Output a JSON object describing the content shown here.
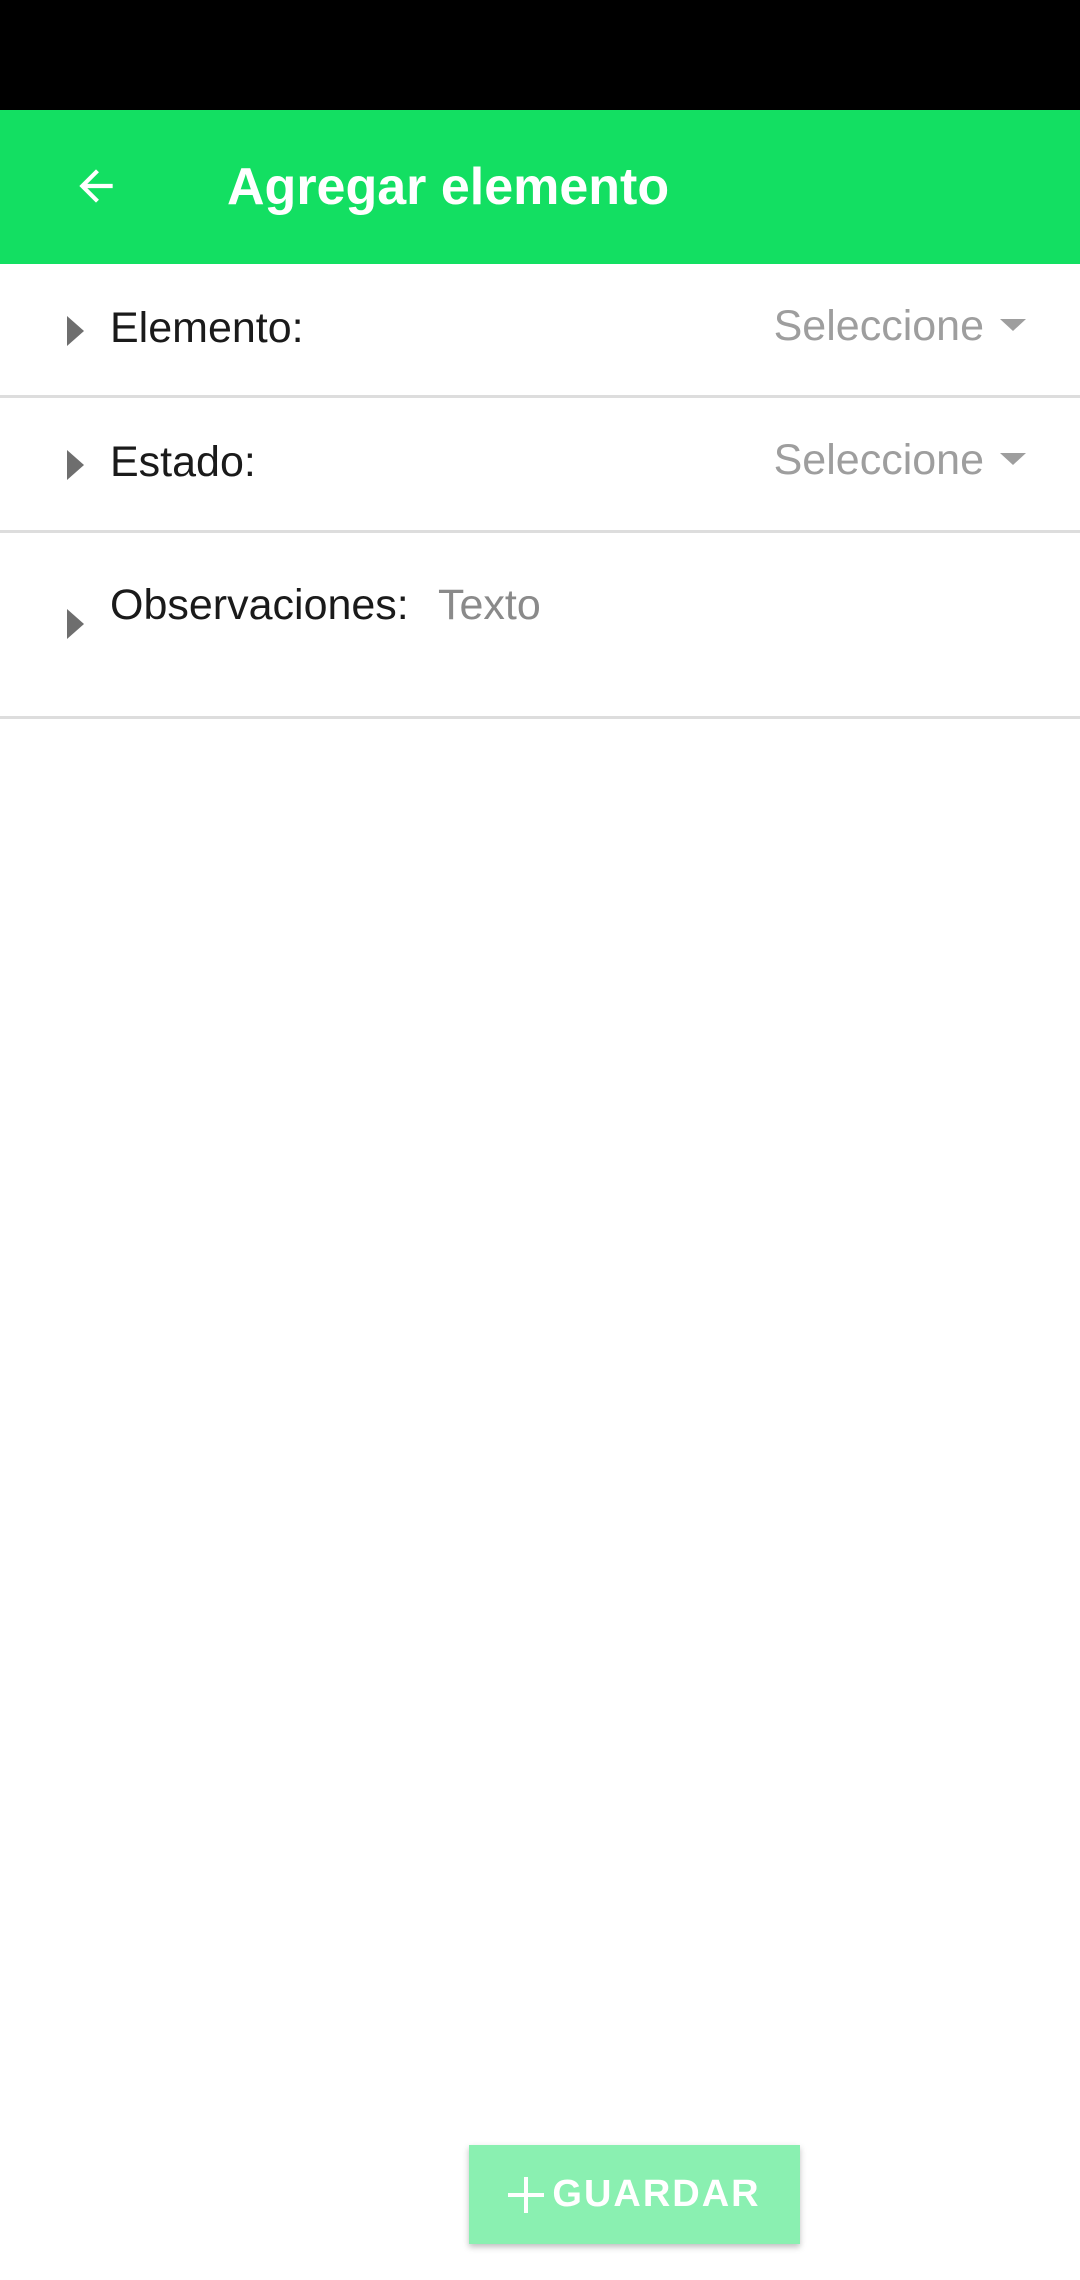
{
  "app_bar": {
    "title": "Agregar elemento",
    "back_icon": "arrow-left-icon",
    "background_color": "#13df62"
  },
  "form": {
    "elemento": {
      "label": "Elemento:",
      "value": "Seleccione"
    },
    "estado": {
      "label": "Estado:",
      "value": "Seleccione"
    },
    "observaciones": {
      "label": "Observaciones:",
      "placeholder": "Texto",
      "value": ""
    }
  },
  "actions": {
    "save_label": "GUARDAR",
    "save_icon": "plus-icon",
    "save_color": "#8af0b1"
  }
}
